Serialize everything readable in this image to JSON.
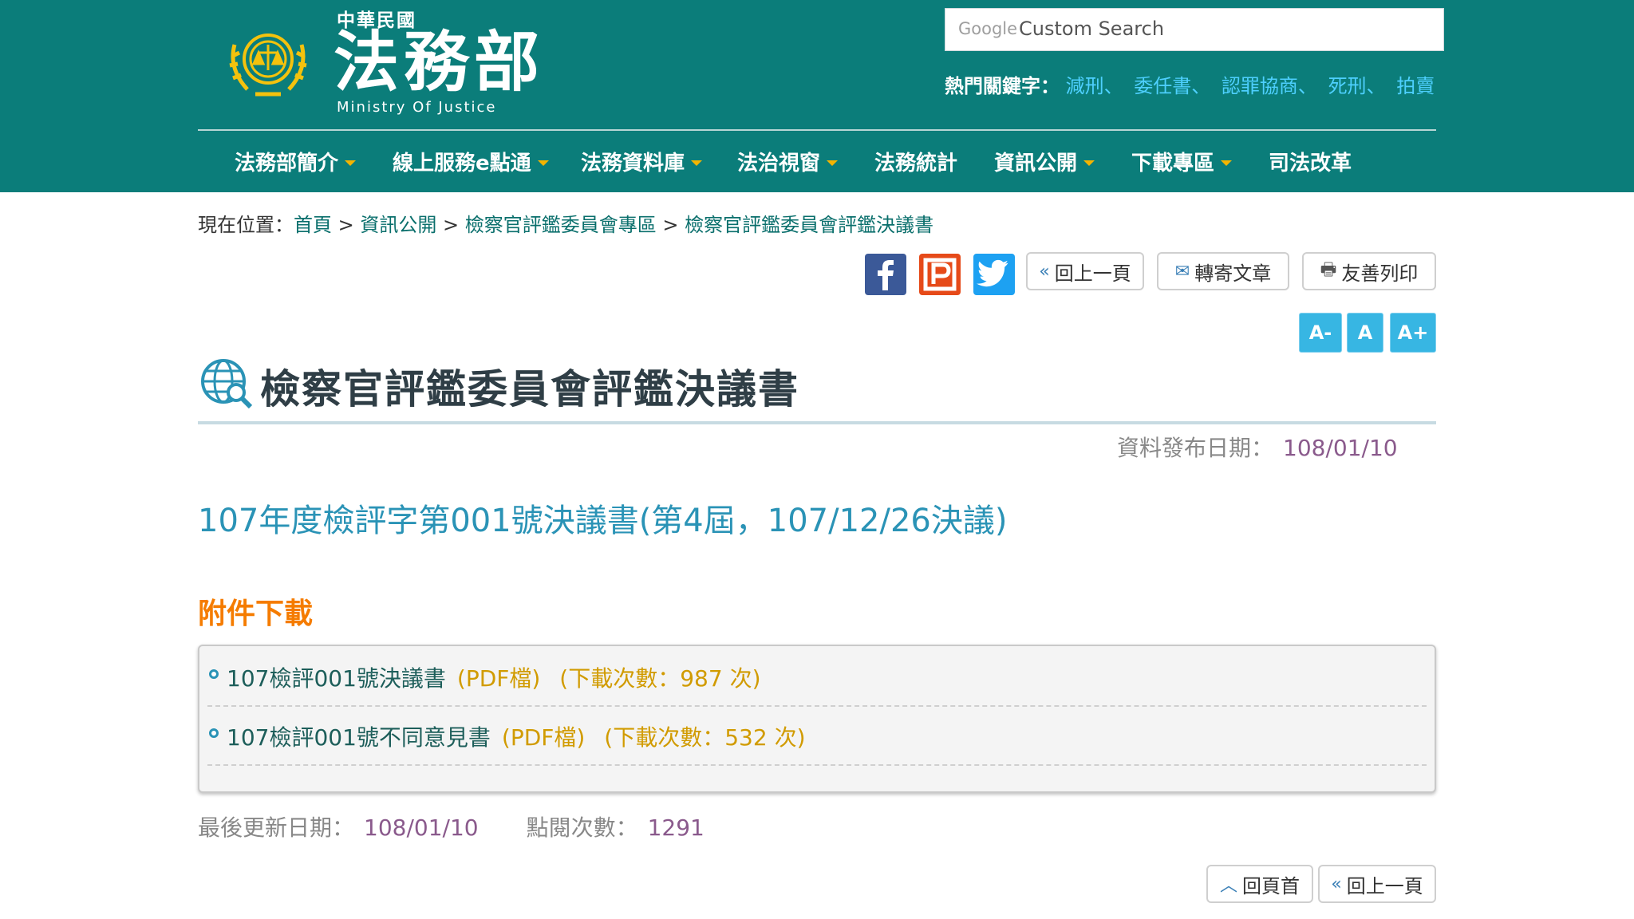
{
  "header": {
    "logo_top": "中華民國",
    "logo_main": "法務部",
    "logo_en": "Ministry Of Justice",
    "search_brand": "Google",
    "search_placeholder": "Custom Search",
    "hot_label": "熱門關鍵字：",
    "hot_keywords": [
      "減刑",
      "委任書",
      "認罪協商",
      "死刑",
      "拍賣"
    ],
    "hot_sep": "、"
  },
  "nav": {
    "items": [
      {
        "label": "法務部簡介"
      },
      {
        "label": "線上服務e點通"
      },
      {
        "label": "法務資料庫"
      },
      {
        "label": "法治視窗"
      },
      {
        "label": "法務統計"
      },
      {
        "label": "資訊公開"
      },
      {
        "label": "下載專區"
      },
      {
        "label": "司法改革"
      }
    ]
  },
  "breadcrumb": {
    "prefix": "現在位置：",
    "links": [
      "首頁",
      "資訊公開",
      "檢察官評鑑委員會專區",
      "檢察官評鑑委員會評鑑決議書"
    ],
    "sep": " > "
  },
  "toolbar": {
    "back_label": "回上一頁",
    "forward_label": "轉寄文章",
    "print_label": "友善列印",
    "font_small": "A-",
    "font_normal": "A",
    "font_large": "A+"
  },
  "content": {
    "page_title": "檢察官評鑑委員會評鑑決議書",
    "pub_label": "資料發布日期：",
    "pub_date": "108/01/10",
    "doc_title": "107年度檢評字第001號決議書(第4屆，107/12/26決議)",
    "attach_heading": "附件下載",
    "attachments": [
      {
        "name": "107檢評001號決議書",
        "type": "(PDF檔)",
        "count": "(下載次數：987 次)"
      },
      {
        "name": "107檢評001號不同意見書",
        "type": "(PDF檔)",
        "count": "(下載次數：532 次)"
      }
    ],
    "updated_label": "最後更新日期：",
    "updated_date": "108/01/10",
    "views_label": "點閱次數：",
    "views": "1291"
  },
  "bottom": {
    "top_label": "回頁首",
    "back_label": "回上一頁"
  },
  "colors": {
    "header_bg": "#0b7d7a",
    "accent_blue": "#2a93b6",
    "accent_orange": "#f57c00",
    "font_btn": "#37b6e3"
  }
}
